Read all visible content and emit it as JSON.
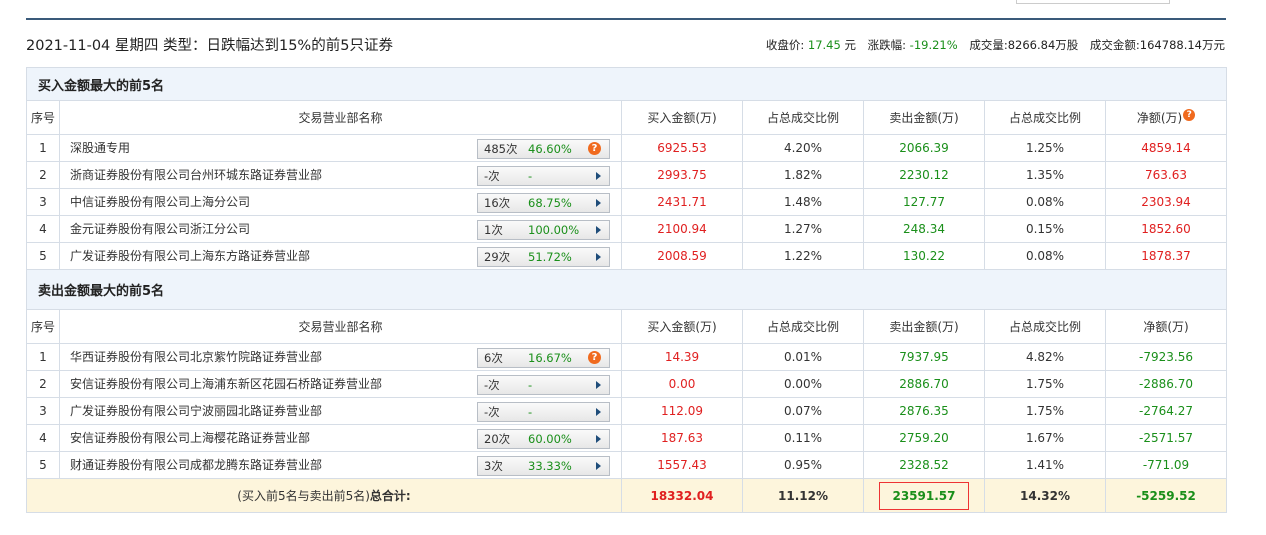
{
  "header": {
    "headline": "2021-11-04 星期四 类型：日跌幅达到15%的前5只证券",
    "close_label": "收盘价:",
    "close_value": "17.45",
    "close_unit": "元",
    "change_label": "涨跌幅:",
    "change_value": "-19.21%",
    "volume_label": "成交量:",
    "volume_value": "8266.84万股",
    "amount_label": "成交金额:",
    "amount_value": "164788.14万元"
  },
  "columns": [
    "序号",
    "交易营业部名称",
    "买入金额(万)",
    "占总成交比例",
    "卖出金额(万)",
    "占总成交比例",
    "净额(万)"
  ],
  "help_mark": "?",
  "buy_section": {
    "title": "买入金额最大的前5名",
    "rows": [
      {
        "idx": "1",
        "name": "深股通专用",
        "times": "485次",
        "rate": "46.60%",
        "has_help": true,
        "buy": "6925.53",
        "buy_pct": "4.20%",
        "sell": "2066.39",
        "sell_pct": "1.25%",
        "net": "4859.14"
      },
      {
        "idx": "2",
        "name": "浙商证券股份有限公司台州环城东路证券营业部",
        "times": "-次",
        "rate": "-",
        "has_help": false,
        "buy": "2993.75",
        "buy_pct": "1.82%",
        "sell": "2230.12",
        "sell_pct": "1.35%",
        "net": "763.63"
      },
      {
        "idx": "3",
        "name": "中信证券股份有限公司上海分公司",
        "times": "16次",
        "rate": "68.75%",
        "has_help": false,
        "buy": "2431.71",
        "buy_pct": "1.48%",
        "sell": "127.77",
        "sell_pct": "0.08%",
        "net": "2303.94"
      },
      {
        "idx": "4",
        "name": "金元证券股份有限公司浙江分公司",
        "times": "1次",
        "rate": "100.00%",
        "has_help": false,
        "buy": "2100.94",
        "buy_pct": "1.27%",
        "sell": "248.34",
        "sell_pct": "0.15%",
        "net": "1852.60"
      },
      {
        "idx": "5",
        "name": "广发证券股份有限公司上海东方路证券营业部",
        "times": "29次",
        "rate": "51.72%",
        "has_help": false,
        "buy": "2008.59",
        "buy_pct": "1.22%",
        "sell": "130.22",
        "sell_pct": "0.08%",
        "net": "1878.37"
      }
    ]
  },
  "sell_section": {
    "title": "卖出金额最大的前5名",
    "rows": [
      {
        "idx": "1",
        "name": "华西证券股份有限公司北京紫竹院路证券营业部",
        "times": "6次",
        "rate": "16.67%",
        "has_help": true,
        "buy": "14.39",
        "buy_pct": "0.01%",
        "sell": "7937.95",
        "sell_pct": "4.82%",
        "net": "-7923.56"
      },
      {
        "idx": "2",
        "name": "安信证券股份有限公司上海浦东新区花园石桥路证券营业部",
        "times": "-次",
        "rate": "-",
        "has_help": false,
        "buy": "0.00",
        "buy_pct": "0.00%",
        "sell": "2886.70",
        "sell_pct": "1.75%",
        "net": "-2886.70"
      },
      {
        "idx": "3",
        "name": "广发证券股份有限公司宁波丽园北路证券营业部",
        "times": "-次",
        "rate": "-",
        "has_help": false,
        "buy": "112.09",
        "buy_pct": "0.07%",
        "sell": "2876.35",
        "sell_pct": "1.75%",
        "net": "-2764.27"
      },
      {
        "idx": "4",
        "name": "安信证券股份有限公司上海樱花路证券营业部",
        "times": "20次",
        "rate": "60.00%",
        "has_help": false,
        "buy": "187.63",
        "buy_pct": "0.11%",
        "sell": "2759.20",
        "sell_pct": "1.67%",
        "net": "-2571.57"
      },
      {
        "idx": "5",
        "name": "财通证券股份有限公司成都龙腾东路证券营业部",
        "times": "3次",
        "rate": "33.33%",
        "has_help": false,
        "buy": "1557.43",
        "buy_pct": "0.95%",
        "sell": "2328.52",
        "sell_pct": "1.41%",
        "net": "-771.09"
      }
    ]
  },
  "total": {
    "label_prefix": "(买入前5名与卖出前5名)",
    "label_bold": "总合计:",
    "buy": "18332.04",
    "buy_pct": "11.12%",
    "sell": "23591.57",
    "sell_pct": "14.32%",
    "net": "-5259.52"
  }
}
